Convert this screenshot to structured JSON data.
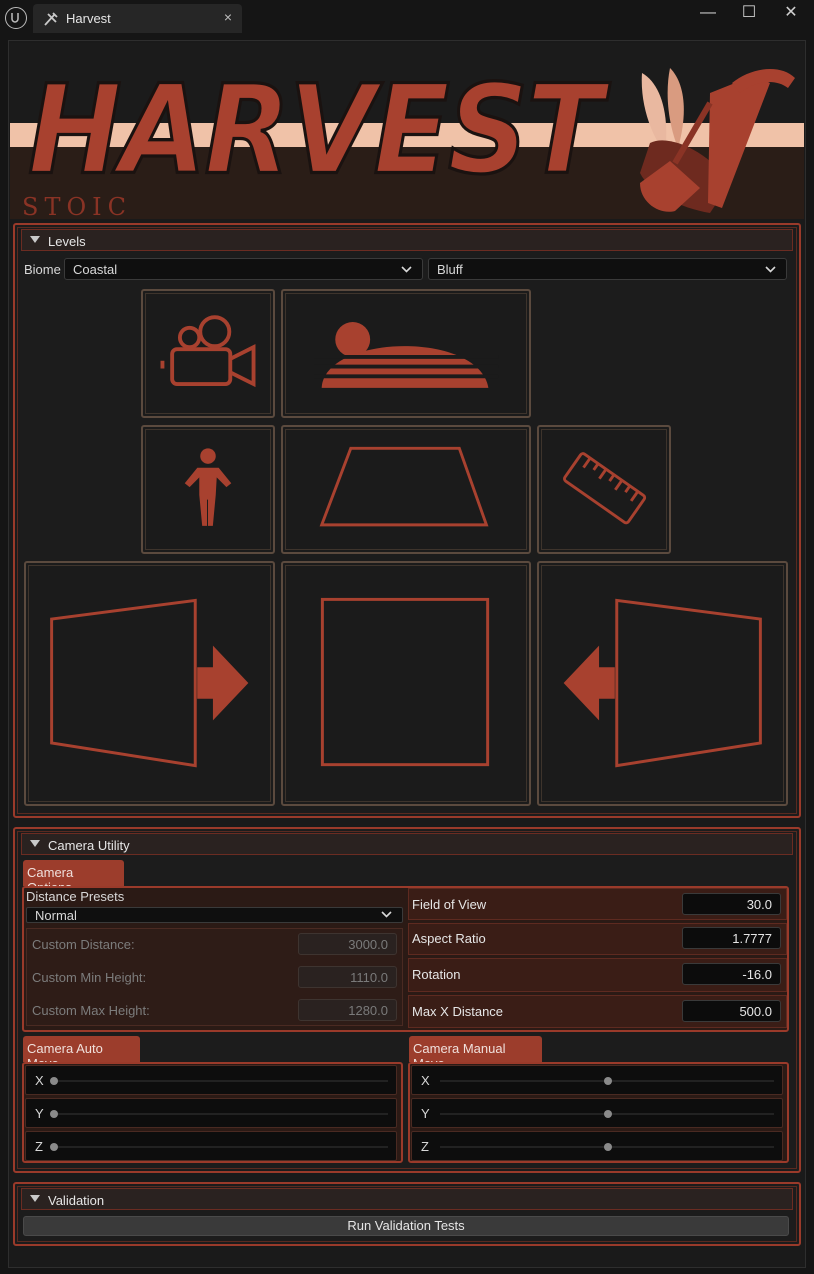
{
  "window": {
    "tab_title": "Harvest",
    "tab_close": "×",
    "minimize": "—",
    "maximize": "☐",
    "close": "✕"
  },
  "banner": {
    "logo_text": "HARVEST",
    "sub_text": "STOIC",
    "colors": {
      "brand_red": "#a8412f",
      "peach": "#f0c2a8",
      "dark_brown": "#2a1d17"
    }
  },
  "levels": {
    "title": "Levels",
    "biome_label": "Biome",
    "biome_value": "Coastal",
    "level_value": "Bluff",
    "tiles": [
      "camera-icon",
      "horizon-icon",
      "character-icon",
      "floor-plane-icon",
      "ruler-icon",
      "move-left-in-icon",
      "frame-icon",
      "move-right-in-icon"
    ]
  },
  "camera_utility": {
    "title": "Camera Utility",
    "options_tab": "Camera Options",
    "distance_presets_label": "Distance Presets",
    "distance_preset_value": "Normal",
    "custom_distance_label": "Custom Distance:",
    "custom_distance_value": "3000.0",
    "custom_min_height_label": "Custom Min Height:",
    "custom_min_height_value": "1110.0",
    "custom_max_height_label": "Custom Max Height:",
    "custom_max_height_value": "1280.0",
    "fov_label": "Field of View",
    "fov_value": "30.0",
    "aspect_label": "Aspect Ratio",
    "aspect_value": "1.7777",
    "rotation_label": "Rotation",
    "rotation_value": "-16.0",
    "max_x_label": "Max X Distance",
    "max_x_value": "500.0",
    "auto_move_tab": "Camera Auto Move",
    "manual_move_tab": "Camera Manual Move",
    "auto_axes": [
      {
        "axis": "X",
        "level": 0.0
      },
      {
        "axis": "Y",
        "level": 0.0
      },
      {
        "axis": "Z",
        "level": 0.0
      }
    ],
    "manual_axes": [
      {
        "axis": "X",
        "level": 0.5
      },
      {
        "axis": "Y",
        "level": 0.5
      },
      {
        "axis": "Z",
        "level": 0.5
      }
    ]
  },
  "validation": {
    "title": "Validation",
    "run_button": "Run Validation Tests"
  }
}
